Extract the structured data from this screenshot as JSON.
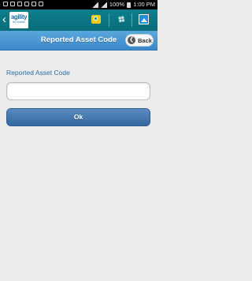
{
  "status_bar": {
    "battery": "100%",
    "time": "1:00 PM"
  },
  "header": {
    "logo_text": "agility",
    "logo_sub": "for mobile",
    "icons": [
      "camera-icon",
      "paperclip-icon",
      "image-icon"
    ],
    "brand_color": "#0c7f8b"
  },
  "title_bar": {
    "title": "Reported Asset Code",
    "back_label": "Back",
    "color": "#3a88c9"
  },
  "form": {
    "field_label": "Reported Asset Code",
    "field_value": "",
    "ok_label": "Ok",
    "button_color": "#3f73aa"
  }
}
